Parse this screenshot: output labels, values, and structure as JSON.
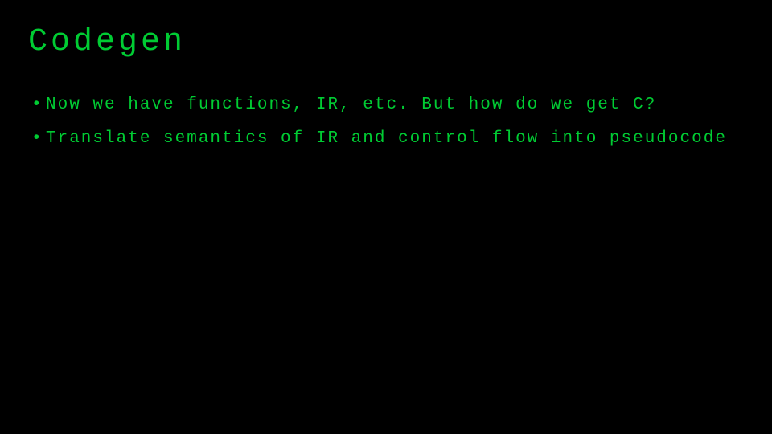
{
  "slide": {
    "title": "Codegen",
    "bullets": [
      "Now we have functions, IR, etc. But how do we get C?",
      "Translate semantics of IR and control flow into pseudocode"
    ]
  }
}
